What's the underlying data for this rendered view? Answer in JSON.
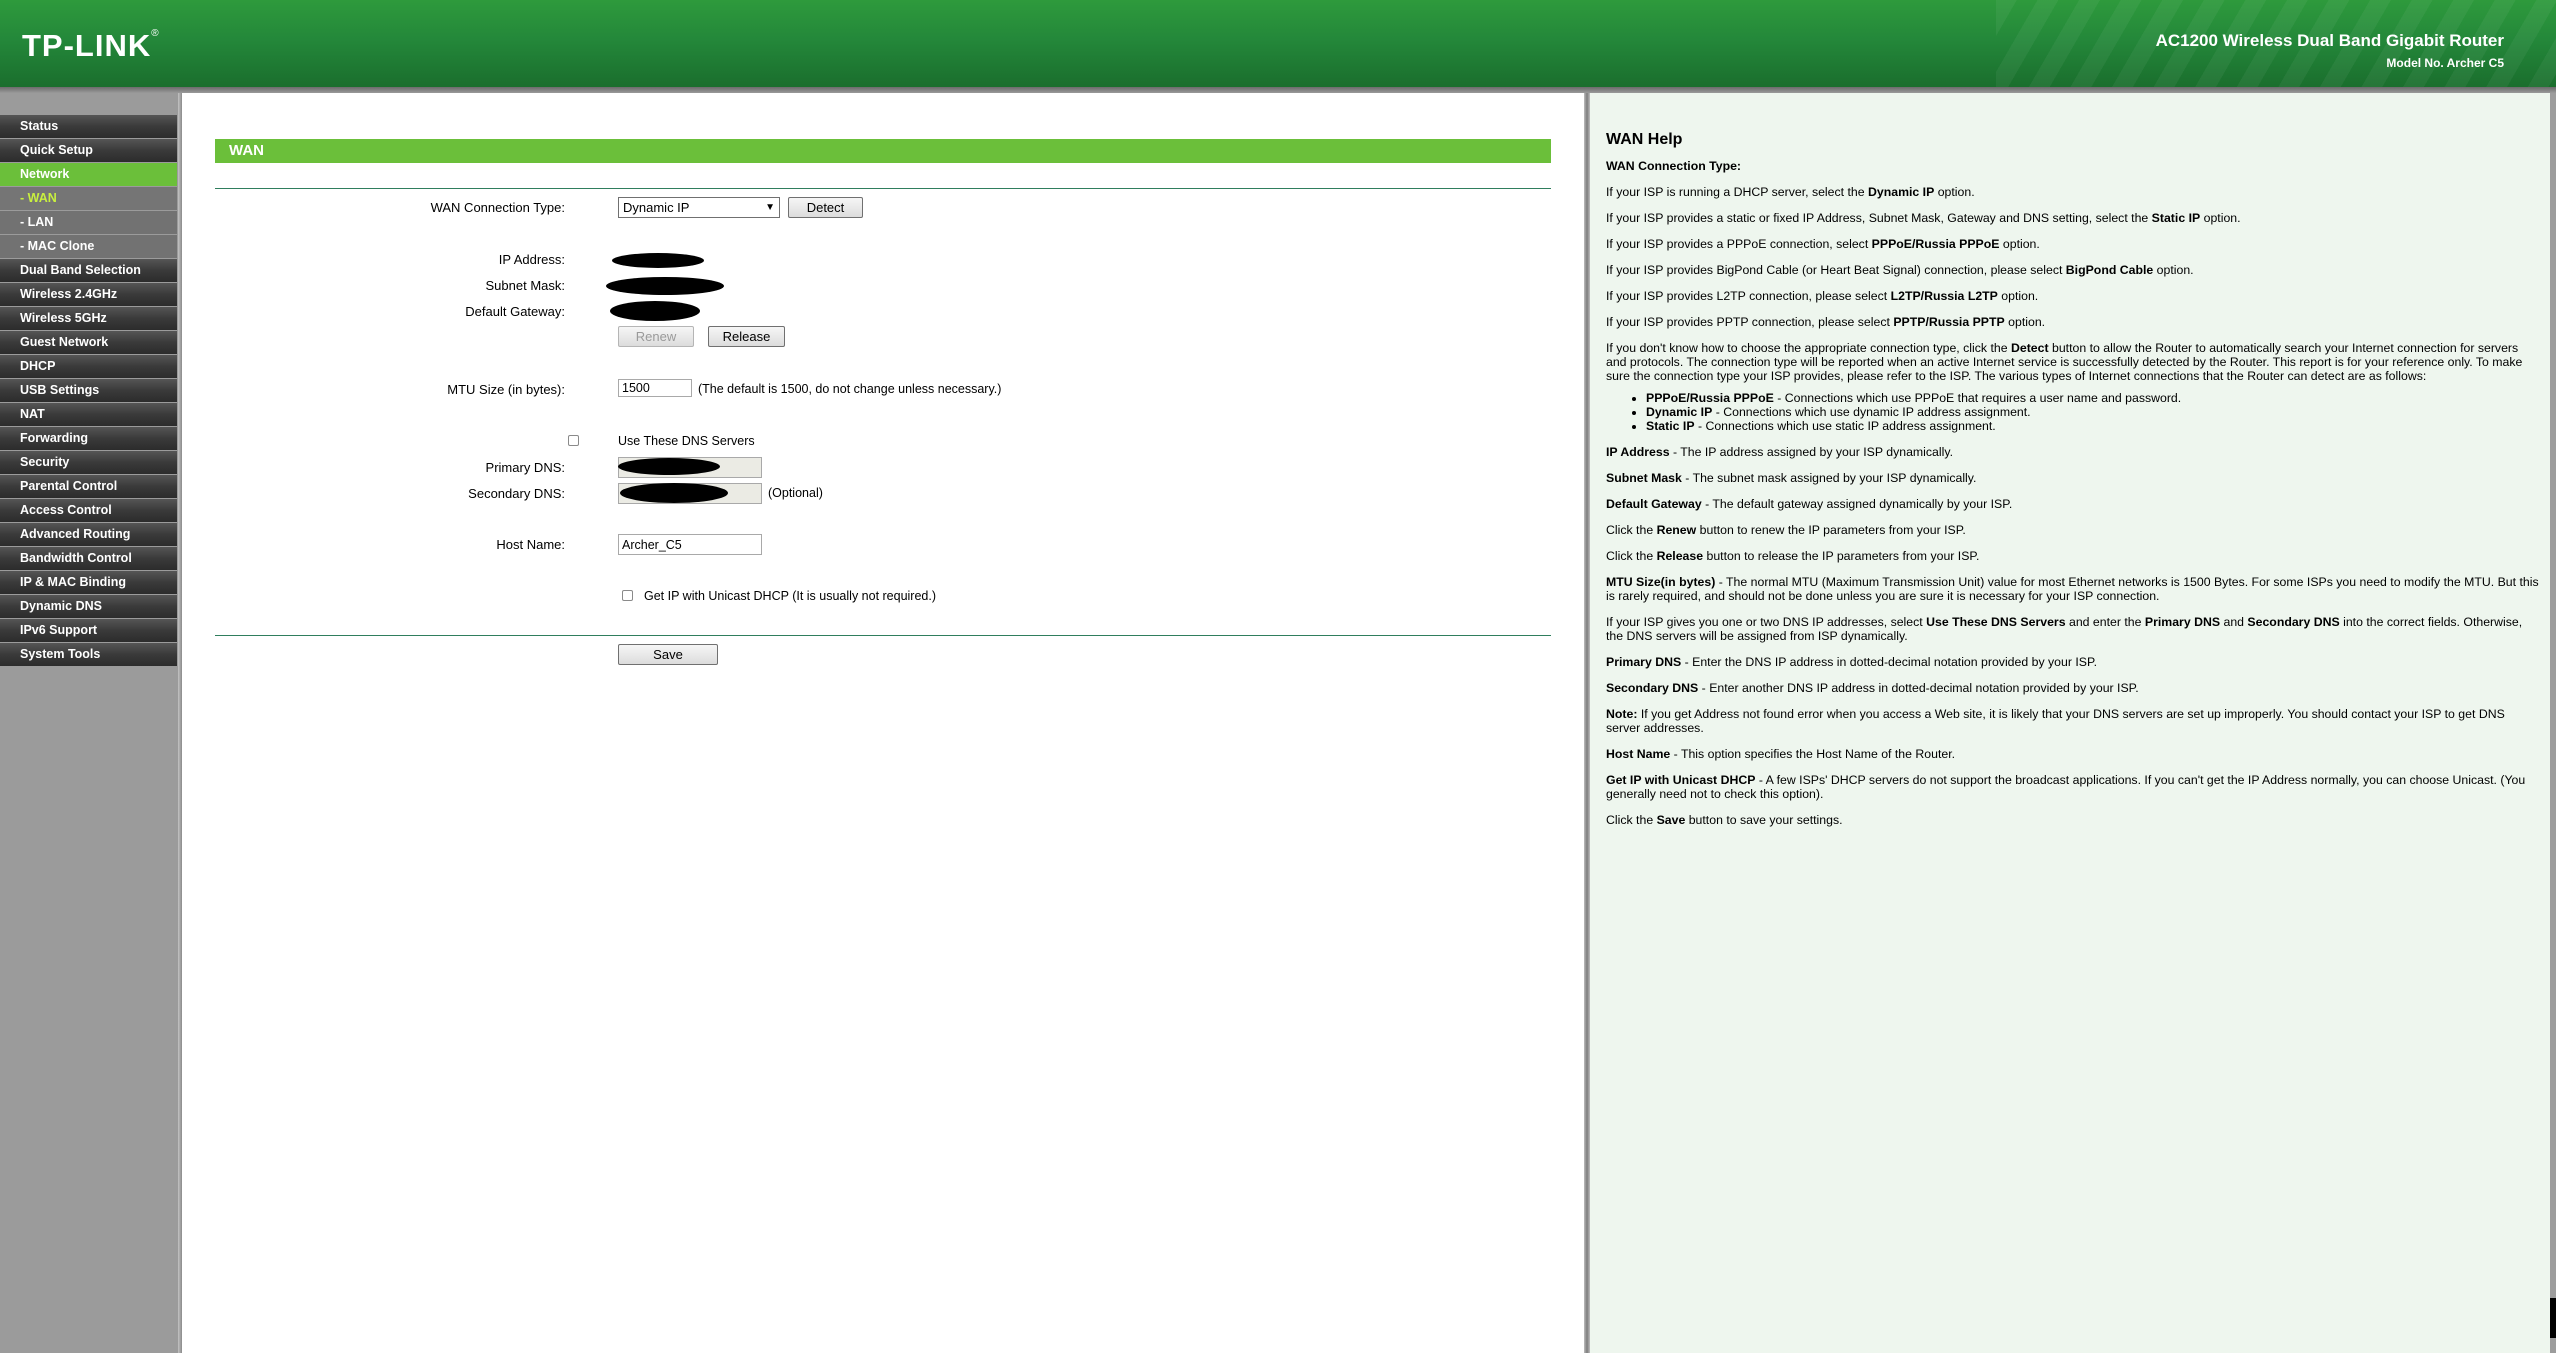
{
  "header": {
    "logo": "TP-LINK",
    "logo_mark": "®",
    "product_name": "AC1200 Wireless Dual Band Gigabit Router",
    "model_no": "Model No. Archer C5"
  },
  "menu": [
    {
      "label": "Status"
    },
    {
      "label": "Quick Setup"
    },
    {
      "label": "Network"
    },
    {
      "label": "- WAN"
    },
    {
      "label": "- LAN"
    },
    {
      "label": "- MAC Clone"
    },
    {
      "label": "Dual Band Selection"
    },
    {
      "label": "Wireless 2.4GHz"
    },
    {
      "label": "Wireless 5GHz"
    },
    {
      "label": "Guest Network"
    },
    {
      "label": "DHCP"
    },
    {
      "label": "USB Settings"
    },
    {
      "label": "NAT"
    },
    {
      "label": "Forwarding"
    },
    {
      "label": "Security"
    },
    {
      "label": "Parental Control"
    },
    {
      "label": "Access Control"
    },
    {
      "label": "Advanced Routing"
    },
    {
      "label": "Bandwidth Control"
    },
    {
      "label": "IP & MAC Binding"
    },
    {
      "label": "Dynamic DNS"
    },
    {
      "label": "IPv6 Support"
    },
    {
      "label": "System Tools"
    }
  ],
  "form": {
    "title": "WAN",
    "wan_type_label": "WAN Connection Type:",
    "wan_type_value": "Dynamic IP",
    "detect_label": "Detect",
    "ip_label": "IP Address:",
    "subnet_label": "Subnet Mask:",
    "gateway_label": "Default Gateway:",
    "renew_label": "Renew",
    "release_label": "Release",
    "mtu_label": "MTU Size (in bytes):",
    "mtu_value": "1500",
    "mtu_note": "(The default is 1500, do not change unless necessary.)",
    "use_dns_label": "Use These DNS Servers",
    "primary_dns_label": "Primary DNS:",
    "secondary_dns_label": "Secondary DNS:",
    "optional_note": "(Optional)",
    "host_name_label": "Host Name:",
    "host_name_value": "Archer_C5",
    "unicast_label": "Get IP with Unicast DHCP (It is usually not required.)",
    "save_label": "Save"
  },
  "help": {
    "title": "WAN Help",
    "subtitle": "WAN Connection Type:"
  }
}
